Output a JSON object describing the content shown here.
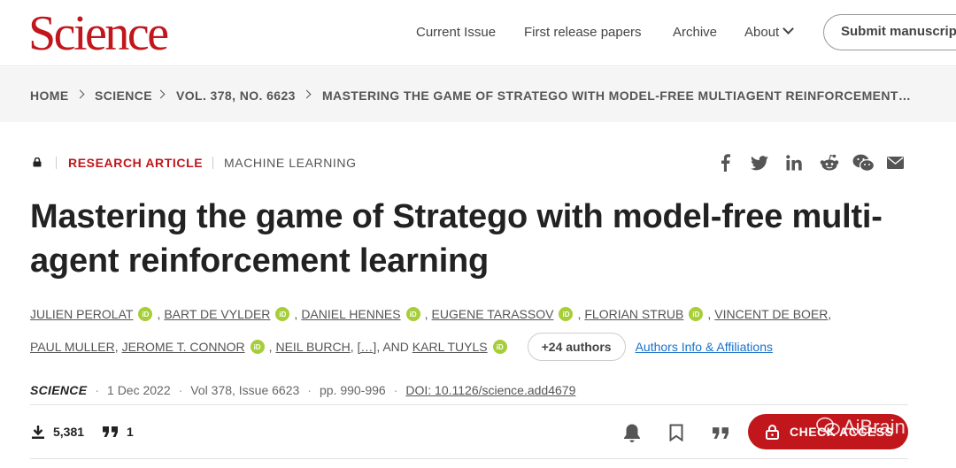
{
  "header": {
    "logo": "Science",
    "nav": [
      "Current Issue",
      "First release papers",
      "Archive",
      "About"
    ],
    "submit_label": "Submit manuscript"
  },
  "breadcrumb": [
    "HOME",
    "SCIENCE",
    "VOL. 378, NO. 6623",
    "MASTERING THE GAME OF STRATEGO WITH MODEL-FREE MULTIAGENT REINFORCEMENT…"
  ],
  "article": {
    "type": "RESEARCH ARTICLE",
    "topic": "MACHINE LEARNING",
    "title": "Mastering the game of Stratego with model-free multi-agent reinforcement learning",
    "authors_line1": [
      "JULIEN PEROLAT",
      "BART DE VYLDER",
      "DANIEL HENNES",
      "EUGENE TARASSOV",
      "FLORIAN STRUB",
      "VINCENT DE BOER"
    ],
    "authors_line2": [
      "PAUL MULLER",
      "JEROME T. CONNOR",
      "NEIL BURCH"
    ],
    "ellipsis": "[…]",
    "and_label": ", AND ",
    "last_author": "KARL TUYLS",
    "more_authors": "+24 authors",
    "affiliations_link": "Authors Info & Affiliations",
    "orcid_label": "iD"
  },
  "citation": {
    "journal": "SCIENCE",
    "date": "1 Dec 2022",
    "volume": "Vol 378, Issue 6623",
    "pages": "pp. 990-996",
    "doi": "DOI: 10.1126/science.add4679"
  },
  "metrics": {
    "downloads": "5,381",
    "citations": "1"
  },
  "access_label": "CHECK ACCESS",
  "watermark": "AiBrain",
  "share_icons": [
    "facebook-icon",
    "twitter-icon",
    "linkedin-icon",
    "reddit-icon",
    "wechat-icon",
    "email-icon"
  ],
  "colors": {
    "brand_red": "#c0161c",
    "link_blue": "#1a73c9",
    "orcid_green": "#a6ce39"
  }
}
